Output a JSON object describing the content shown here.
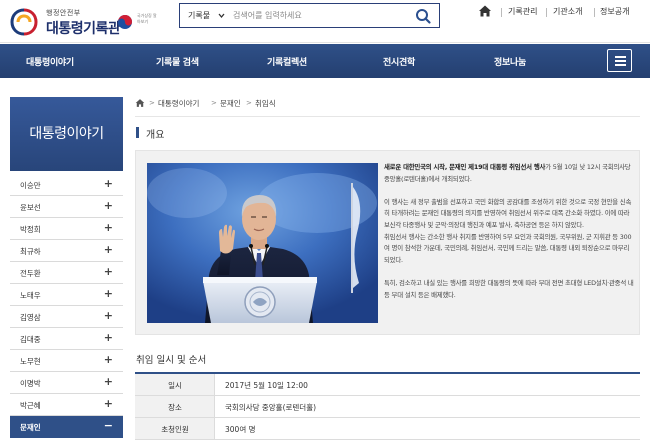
{
  "header": {
    "ministry": "행정안전부",
    "site_name": "대통령기록관",
    "emblem_caption": "국가상징 알아보기",
    "search": {
      "category": "기록물",
      "placeholder": "검색어를 입력하세요"
    },
    "util_links": [
      "기록관리",
      "기관소개",
      "정보공개"
    ]
  },
  "gnb": {
    "items": [
      "대통령이야기",
      "기록물 검색",
      "기록컬렉션",
      "전시견학",
      "정보나눔"
    ]
  },
  "sidebar": {
    "title": "대통령이야기",
    "items": [
      {
        "label": "이승만",
        "toggle": "+"
      },
      {
        "label": "윤보선",
        "toggle": "+"
      },
      {
        "label": "박정희",
        "toggle": "+"
      },
      {
        "label": "최규하",
        "toggle": "+"
      },
      {
        "label": "전두환",
        "toggle": "+"
      },
      {
        "label": "노태우",
        "toggle": "+"
      },
      {
        "label": "김영삼",
        "toggle": "+"
      },
      {
        "label": "김대중",
        "toggle": "+"
      },
      {
        "label": "노무현",
        "toggle": "+"
      },
      {
        "label": "이명박",
        "toggle": "+"
      },
      {
        "label": "박근혜",
        "toggle": "+"
      },
      {
        "label": "문재인",
        "toggle": "−"
      }
    ],
    "active_index": 11
  },
  "breadcrumb": [
    "대통령이야기",
    "문재인",
    "취임식"
  ],
  "overview": {
    "title": "개요",
    "lead_bold": "새로운 대한민국의 시작, 문재인 제19대 대통령 취임선서 행사",
    "lead_rest": "가 5월 10일 낮 12시 국회의사당 중앙홀(로텐더홀)에서 개최되었다.",
    "paragraphs": [
      "이 행사는 새 정부 출범을 선포하고 국민 화합의 공감대를 조성하기 위한 것으로 국정 현안을 신속히 타개하려는 문재인 대통령의 의지를 반영하여 취임선서 위주로 대폭 간소화 하였다. 이에 따라 보신각 타종행사 및 군악·의장대 행진과 예포 발사, 축하공연 등은 하지 않았다.",
      "취임선서 행사는 간소한 행사 취지를 반영하여 5부 요인과 국회의원, 국무위원, 군 지휘관 등 300여 명이 참석한 가운데, 국민의례, 취임선서, 국민께 드리는 말씀, 대통령 내외 퇴장순으로 마무리 되었다.",
      "특히, 검소하고 내실 있는 행사를 희망한 대통령의 뜻에 따라 무대 전면 초대형 LED설치·관중석 내 등 무대 설치 등은 배제했다."
    ]
  },
  "schedule": {
    "title": "취임 일시 및 순서",
    "rows": [
      {
        "label": "일시",
        "value": "2017년 5월 10일 12:00"
      },
      {
        "label": "장소",
        "value": "국회의사당 중앙홀(로텐더홀)"
      },
      {
        "label": "초청인원",
        "value": "300여 명"
      }
    ]
  },
  "colors": {
    "navy": "#2f5088",
    "title_navy": "#1d2f6b",
    "box_gray": "#f1f1f1"
  }
}
